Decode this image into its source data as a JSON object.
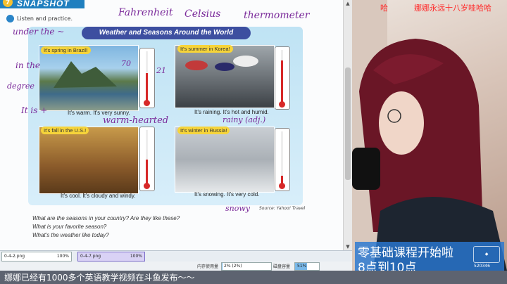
{
  "textbook": {
    "section_number": "7",
    "section_title": "SNAPSHOT",
    "listen_label": "Listen and practice.",
    "banner_title": "Weather and Seasons Around the World",
    "panels": [
      {
        "caption": "It's spring in Brazil!",
        "sentence": "It's warm. It's very sunny."
      },
      {
        "caption": "It's summer in Korea!",
        "sentence": "It's raining. It's hot and humid."
      },
      {
        "caption": "It's fall in the U.S.!",
        "sentence": "It's cool. It's cloudy and windy."
      },
      {
        "caption": "It's winter in Russia!",
        "sentence": "It's snowing. It's very cold."
      }
    ],
    "source": "Source: Yahoo! Travel",
    "questions": [
      "What are the seasons in your country? Are they like these?",
      "What is your favorite season?",
      "What's the weather like today?"
    ],
    "thermometers": [
      {
        "level": 0.55,
        "color": "#d72828"
      },
      {
        "level": 0.8,
        "color": "#d72828"
      },
      {
        "level": 0.45,
        "color": "#d72828"
      },
      {
        "level": 0.15,
        "color": "#d72828"
      }
    ]
  },
  "annotations": {
    "fahrenheit": "Fahrenheit",
    "celsius": "Celsius",
    "thermometer": "thermometer",
    "under_the": "under the ~",
    "in_the": "in the",
    "degree": "degree",
    "it_is": "It is +",
    "warm_hearted": "warm-hearted",
    "rainy_adj": "rainy (adj.)",
    "snowy": "snowy",
    "number_70": "70",
    "number_21": "21"
  },
  "taskbar": {
    "tabs": [
      {
        "name": "0-4-2.png",
        "zoom": "100%"
      },
      {
        "name": "0-4-7.png",
        "zoom": "100%"
      }
    ],
    "memory_label": "内存使用量",
    "memory_value": "2% (2%)",
    "memory_level": 0.02,
    "disk_label": "磁盘容量",
    "disk_value": "51%",
    "disk_level": 0.51
  },
  "stream": {
    "top_left_text": "哈",
    "top_right_text": "娜娜永远十八岁哇哈哈",
    "overlay_line1": "零基础课程开始啦",
    "overlay_line2": "8点到10点",
    "room_number": "520346",
    "ticker": "娜娜已经有1000多个英语教学视频在斗鱼发布～～"
  },
  "colors": {
    "accent": "#1f7fbf",
    "banner": "#3d4fa0",
    "caption": "#f6d43a",
    "ink": "#7a2a9a",
    "overlay": "#2878d2"
  }
}
